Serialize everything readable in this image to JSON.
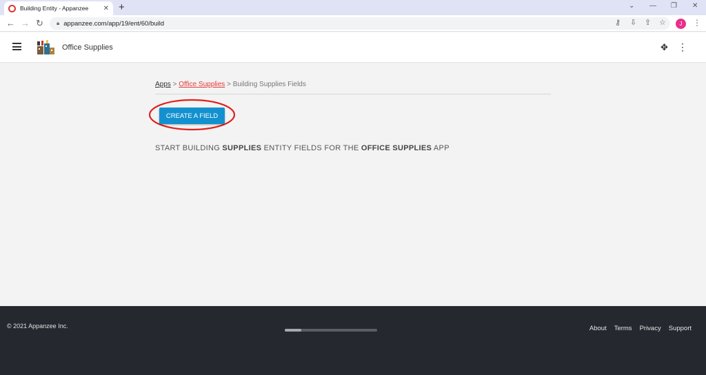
{
  "browser": {
    "tab_title": "Building Entity - Appanzee",
    "tab_close": "✕",
    "new_tab": "+",
    "url": "appanzee.com/app/19/ent/60/build",
    "profile_initial": "J"
  },
  "app": {
    "name": "Office Supplies"
  },
  "breadcrumb": {
    "apps": "Apps",
    "sep1": " > ",
    "office": "Office Supplies",
    "sep2": " > ",
    "current": "Building Supplies Fields"
  },
  "actions": {
    "create_field": "CREATE A FIELD"
  },
  "message": {
    "part1": "START BUILDING ",
    "entity": "SUPPLIES",
    "part2": " ENTITY FIELDS FOR THE ",
    "app": "OFFICE SUPPLIES",
    "part3": " APP"
  },
  "footer": {
    "copyright": "© 2021 Appanzee Inc.",
    "links": [
      "About",
      "Terms",
      "Privacy",
      "Support"
    ]
  },
  "colors": {
    "primary_button": "#1391cf",
    "highlight_ring": "#e0201b",
    "link_red": "#e53935",
    "footer_bg": "#26282f"
  }
}
